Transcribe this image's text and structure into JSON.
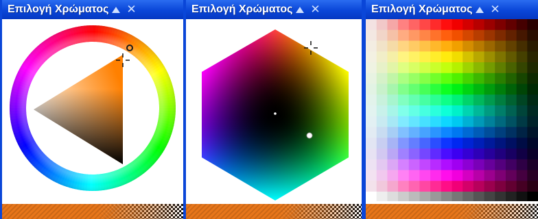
{
  "panels": {
    "wheel": {
      "title": "Επιλογή Χρώματος",
      "close_glyph": "✕",
      "collapse_icon": "triangle-up-icon",
      "close_icon": "close-icon"
    },
    "hexagon": {
      "title": "Επιλογή Χρώματος",
      "close_glyph": "✕",
      "collapse_icon": "triangle-up-icon",
      "close_icon": "close-icon"
    },
    "swatches": {
      "title": "Επιλογή Χρώματος",
      "close_glyph": "✕",
      "collapse_icon": "triangle-up-icon",
      "close_icon": "close-icon"
    }
  },
  "colors": {
    "title_bar": "#0a46d8",
    "border": "#0a46d8",
    "current_color": "#e8761a",
    "wheel_hue": "#ff8000"
  },
  "swatch_grid": {
    "columns": 16,
    "rows": 16
  }
}
